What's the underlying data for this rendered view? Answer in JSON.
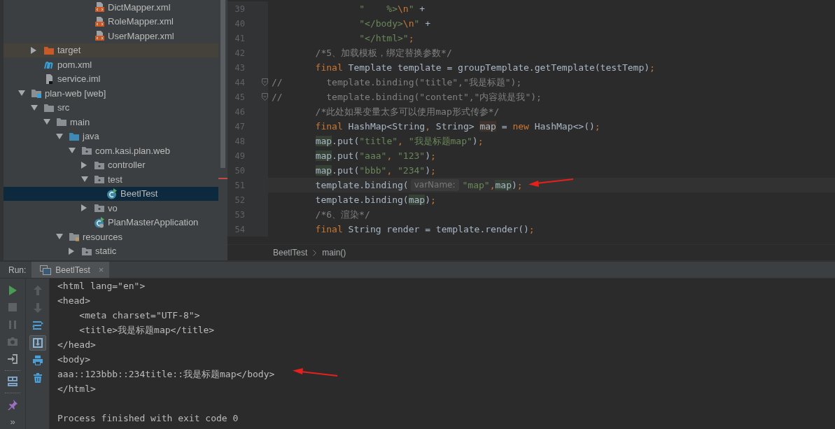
{
  "project_tree": [
    {
      "children": [
        {
          "children": [
            {
              "children": [
                {
                  "children": [
                    {
                      "children": [
                        {
                          "name": "DictMapper.xml",
                          "kind": "xml",
                          "selected": false
                        },
                        {
                          "name": "RoleMapper.xml",
                          "kind": "xml",
                          "selected": false
                        },
                        {
                          "name": "UserMapper.xml",
                          "kind": "xml",
                          "selected": false
                        }
                      ]
                    }
                  ]
                }
              ]
            }
          ]
        },
        {
          "name": "target",
          "kind": "excluded-folder",
          "expanded": false,
          "selected": false
        },
        {
          "name": "pom.xml",
          "kind": "maven",
          "selected": false
        },
        {
          "name": "service.iml",
          "kind": "iml",
          "selected": false
        }
      ]
    },
    {
      "name": "plan-web [web]",
      "kind": "module",
      "expanded": true,
      "selected": false,
      "children": [
        {
          "name": "src",
          "kind": "folder",
          "expanded": true,
          "selected": false,
          "children": [
            {
              "name": "main",
              "kind": "folder",
              "expanded": true,
              "selected": false,
              "children": [
                {
                  "name": "java",
                  "kind": "source-folder",
                  "expanded": true,
                  "selected": false,
                  "children": [
                    {
                      "name": "com.kasi.plan.web",
                      "kind": "package",
                      "expanded": true,
                      "selected": false,
                      "children": [
                        {
                          "name": "controller",
                          "kind": "package",
                          "expanded": false,
                          "selected": false
                        },
                        {
                          "name": "test",
                          "kind": "package",
                          "expanded": true,
                          "selected": false,
                          "children": [
                            {
                              "name": "BeetlTest",
                              "kind": "java-class",
                              "selected": true
                            }
                          ]
                        },
                        {
                          "name": "vo",
                          "kind": "package",
                          "expanded": false,
                          "selected": false
                        },
                        {
                          "name": "PlanMasterApplication",
                          "kind": "spring-class",
                          "selected": false
                        }
                      ]
                    }
                  ]
                },
                {
                  "name": "resources",
                  "kind": "resources-folder",
                  "expanded": true,
                  "selected": false,
                  "children": [
                    {
                      "name": "static",
                      "kind": "package",
                      "expanded": false,
                      "selected": false
                    }
                  ]
                }
              ]
            }
          ]
        }
      ]
    }
  ],
  "editor": {
    "lines": [
      {
        "number": "39",
        "current": false,
        "fold": false,
        "segments": [
          {
            "kind": "string",
            "text": "                \"    %>"
          },
          {
            "kind": "escape",
            "text": "\\n"
          },
          {
            "kind": "string",
            "text": "\""
          },
          {
            "kind": "plain",
            "text": " +"
          }
        ]
      },
      {
        "number": "40",
        "current": false,
        "fold": false,
        "segments": [
          {
            "kind": "string",
            "text": "                \"</body>"
          },
          {
            "kind": "escape",
            "text": "\\n"
          },
          {
            "kind": "string",
            "text": "\""
          },
          {
            "kind": "plain",
            "text": " +"
          }
        ]
      },
      {
        "number": "41",
        "current": false,
        "fold": false,
        "segments": [
          {
            "kind": "string",
            "text": "                \"</html>\""
          },
          {
            "kind": "punct",
            "text": ";"
          }
        ]
      },
      {
        "number": "42",
        "current": false,
        "fold": false,
        "segments": [
          {
            "kind": "comment",
            "text": "        /*5、加载模板，绑定替换参数*/"
          }
        ]
      },
      {
        "number": "43",
        "current": false,
        "fold": false,
        "segments": [
          {
            "kind": "keyword",
            "text": "        final"
          },
          {
            "kind": "plain",
            "text": " Template template = groupTemplate.getTemplate(testTemp)"
          },
          {
            "kind": "punct",
            "text": ";"
          }
        ]
      },
      {
        "number": "44",
        "current": false,
        "fold": true,
        "segments": [
          {
            "kind": "comment",
            "text": "//        template.binding(\"title\",\"我是标题\");"
          }
        ]
      },
      {
        "number": "45",
        "current": false,
        "fold": true,
        "segments": [
          {
            "kind": "comment",
            "text": "//        template.binding(\"content\",\"内容就是我\");"
          }
        ]
      },
      {
        "number": "46",
        "current": false,
        "fold": false,
        "segments": [
          {
            "kind": "comment",
            "text": "        /*此处如果变量太多可以使用map形式传参*/"
          }
        ]
      },
      {
        "number": "47",
        "current": false,
        "fold": false,
        "segments": [
          {
            "kind": "keyword",
            "text": "        final"
          },
          {
            "kind": "plain",
            "text": " HashMap<String"
          },
          {
            "kind": "punct",
            "text": ","
          },
          {
            "kind": "plain",
            "text": " String> "
          },
          {
            "kind": "decl",
            "text": "map"
          },
          {
            "kind": "plain",
            "text": " = "
          },
          {
            "kind": "keyword",
            "text": "new"
          },
          {
            "kind": "plain",
            "text": " HashMap<>()"
          },
          {
            "kind": "punct",
            "text": ";"
          }
        ]
      },
      {
        "number": "48",
        "current": false,
        "fold": false,
        "segments": [
          {
            "kind": "usage",
            "text": "        map"
          },
          {
            "kind": "plain",
            "text": ".put("
          },
          {
            "kind": "string",
            "text": "\"title\""
          },
          {
            "kind": "punct",
            "text": ","
          },
          {
            "kind": "string",
            "text": " \"我是标题map\""
          },
          {
            "kind": "plain",
            "text": ")"
          },
          {
            "kind": "punct",
            "text": ";"
          }
        ]
      },
      {
        "number": "49",
        "current": false,
        "fold": false,
        "segments": [
          {
            "kind": "usage",
            "text": "        map"
          },
          {
            "kind": "plain",
            "text": ".put("
          },
          {
            "kind": "string",
            "text": "\"aaa\""
          },
          {
            "kind": "punct",
            "text": ","
          },
          {
            "kind": "string",
            "text": " \"123\""
          },
          {
            "kind": "plain",
            "text": ")"
          },
          {
            "kind": "punct",
            "text": ";"
          }
        ]
      },
      {
        "number": "50",
        "current": false,
        "fold": false,
        "segments": [
          {
            "kind": "usage",
            "text": "        map"
          },
          {
            "kind": "plain",
            "text": ".put("
          },
          {
            "kind": "string",
            "text": "\"bbb\""
          },
          {
            "kind": "punct",
            "text": ","
          },
          {
            "kind": "string",
            "text": " \"234\""
          },
          {
            "kind": "plain",
            "text": ")"
          },
          {
            "kind": "punct",
            "text": ";"
          }
        ]
      },
      {
        "number": "51",
        "current": true,
        "fold": false,
        "segments": [
          {
            "kind": "plain",
            "text": "        template.binding("
          },
          {
            "kind": "hint",
            "text": "varName:"
          },
          {
            "kind": "string",
            "text": "\"map\""
          },
          {
            "kind": "punct",
            "text": ","
          },
          {
            "kind": "usage",
            "text": "map"
          },
          {
            "kind": "plain",
            "text": ")"
          },
          {
            "kind": "punct",
            "text": ";"
          }
        ]
      },
      {
        "number": "52",
        "current": false,
        "fold": false,
        "segments": [
          {
            "kind": "plain",
            "text": "        template.binding("
          },
          {
            "kind": "usage",
            "text": "map"
          },
          {
            "kind": "plain",
            "text": ")"
          },
          {
            "kind": "punct",
            "text": ";"
          }
        ]
      },
      {
        "number": "53",
        "current": false,
        "fold": false,
        "segments": [
          {
            "kind": "comment",
            "text": "        /*6、渲染*/"
          }
        ]
      },
      {
        "number": "54",
        "current": false,
        "fold": false,
        "segments": [
          {
            "kind": "keyword",
            "text": "        final"
          },
          {
            "kind": "plain",
            "text": " String render = template.render()"
          },
          {
            "kind": "punct",
            "text": ";"
          }
        ]
      }
    ],
    "breadcrumbs": [
      "BeetlTest",
      "main()"
    ]
  },
  "run_panel": {
    "label": "Run:",
    "tabs": [
      {
        "title": "BeetlTest",
        "close": "×",
        "selected": true
      }
    ],
    "toolbar_primary": [
      {
        "kind": "rerun",
        "disabled": false
      },
      {
        "kind": "stop",
        "disabled": true
      },
      {
        "kind": "pause",
        "disabled": true
      },
      {
        "kind": "camera",
        "disabled": true
      },
      {
        "kind": "exit",
        "disabled": false
      },
      {
        "kind": "separator"
      },
      {
        "kind": "layout",
        "disabled": false
      },
      {
        "kind": "separator"
      },
      {
        "kind": "pin",
        "disabled": false
      },
      {
        "kind": "more",
        "label": "»"
      }
    ],
    "toolbar_secondary": [
      {
        "kind": "up",
        "disabled": true
      },
      {
        "kind": "down",
        "disabled": true
      },
      {
        "kind": "soft-wrap",
        "disabled": false,
        "on": false
      },
      {
        "kind": "scroll-end",
        "disabled": false,
        "on": true
      },
      {
        "kind": "print",
        "disabled": false
      },
      {
        "kind": "trash",
        "disabled": false
      }
    ],
    "console": {
      "lines": [
        "<html lang=\"en\">",
        "<head>",
        "    <meta charset=\"UTF-8\">",
        "    <title>我是标题map</title>",
        "</head>",
        "<body>",
        "aaa::123bbb::234title::我是标题map</body>",
        "</html>"
      ],
      "exit_message": "Process finished with exit code 0"
    }
  }
}
